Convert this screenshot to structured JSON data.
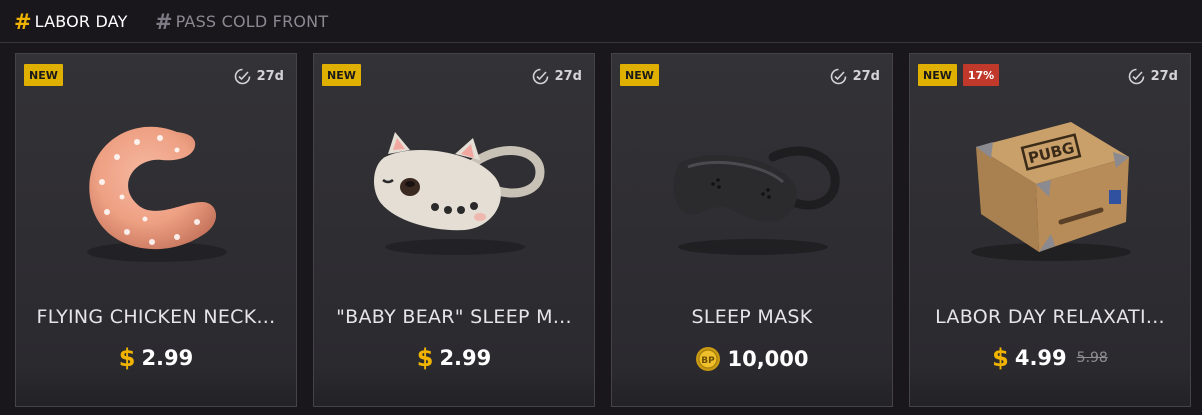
{
  "tabs": [
    {
      "hash": "#",
      "label": "LABOR DAY",
      "active": true
    },
    {
      "hash": "#",
      "label": "PASS COLD FRONT",
      "active": false
    }
  ],
  "colors": {
    "accent": "#f0b400",
    "new_badge": "#e0b000",
    "discount_badge": "#c0392b"
  },
  "items": [
    {
      "name": "FLYING CHICKEN NECK...",
      "badge_new": "NEW",
      "badge_discount": "",
      "timer": "27d",
      "currency_icon": "dollar-sign",
      "currency_symbol": "$",
      "price": "2.99",
      "old_price": "",
      "image": "neck-pillow"
    },
    {
      "name": "\"BABY BEAR\" SLEEP M...",
      "badge_new": "NEW",
      "badge_discount": "",
      "timer": "27d",
      "currency_icon": "dollar-sign",
      "currency_symbol": "$",
      "price": "2.99",
      "old_price": "",
      "image": "bear-sleep-mask"
    },
    {
      "name": "SLEEP MASK",
      "badge_new": "NEW",
      "badge_discount": "",
      "timer": "27d",
      "currency_icon": "bp-coin",
      "currency_symbol": "",
      "price": "10,000",
      "old_price": "",
      "image": "black-sleep-mask"
    },
    {
      "name": "LABOR DAY RELAXATI...",
      "badge_new": "NEW",
      "badge_discount": "17%",
      "timer": "27d",
      "currency_icon": "dollar-sign",
      "currency_symbol": "$",
      "price": "4.99",
      "old_price": "5.98",
      "image": "pubg-crate"
    }
  ]
}
